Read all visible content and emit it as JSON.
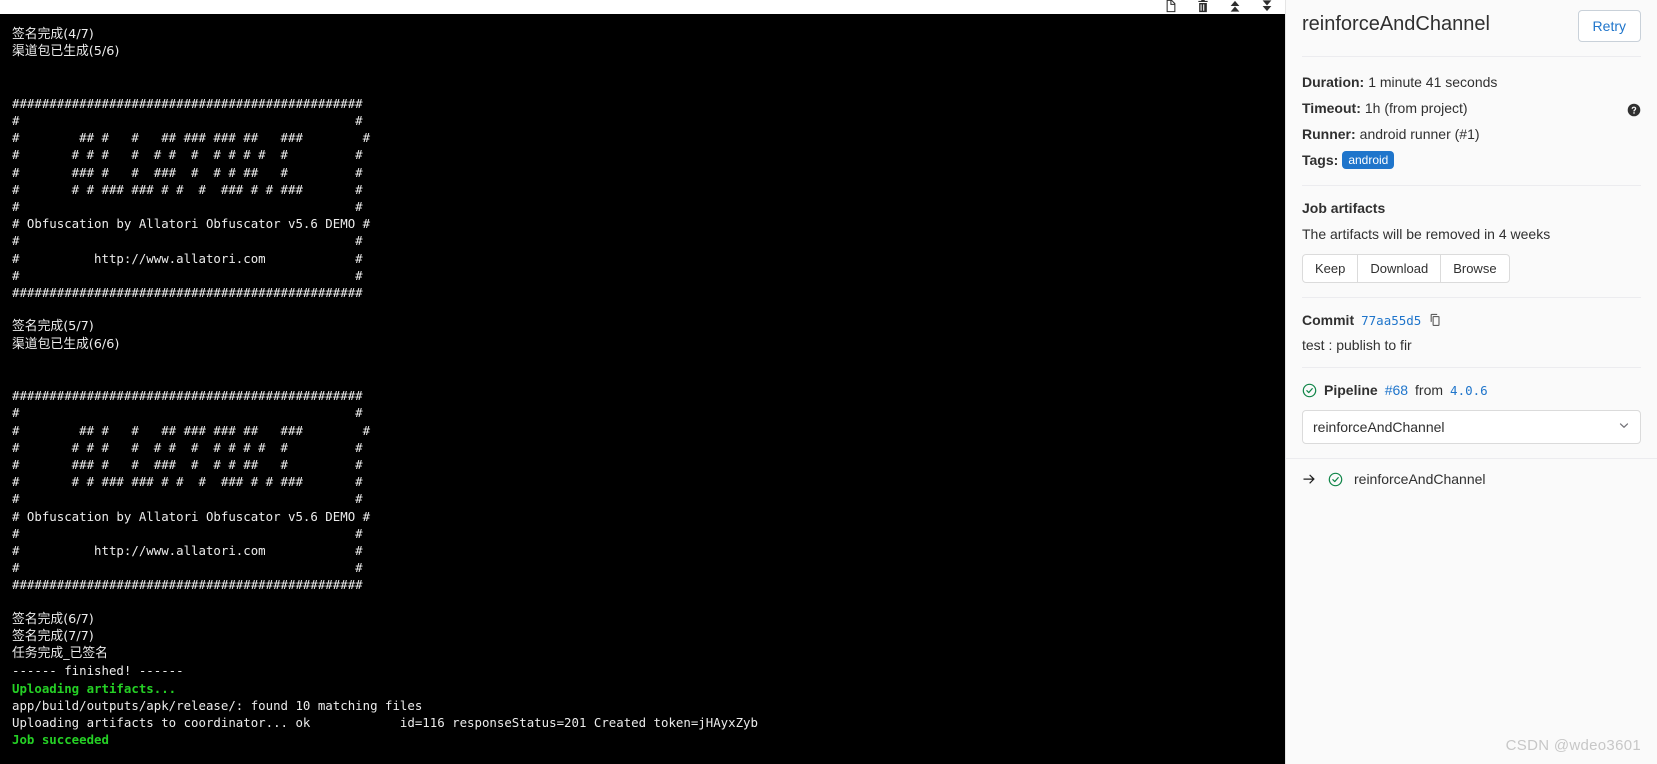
{
  "toolbar": {
    "icons": [
      {
        "name": "open-raw-icon",
        "title": "Show complete raw"
      },
      {
        "name": "trash-icon",
        "title": "Erase job log"
      },
      {
        "name": "scroll-top-icon",
        "title": "Scroll to top"
      },
      {
        "name": "scroll-bottom-icon",
        "title": "Scroll to bottom"
      }
    ]
  },
  "log": {
    "lines": [
      {
        "type": "cn",
        "text": "签名完成(4/7)"
      },
      {
        "type": "cn",
        "text": "渠道包已生成(5/6)"
      },
      {
        "type": "blank",
        "text": ""
      },
      {
        "type": "blank",
        "text": ""
      },
      {
        "type": "mono",
        "text": "###############################################"
      },
      {
        "type": "mono",
        "text": "#                                             #"
      },
      {
        "type": "mono",
        "text": "#        ## #   #   ## ### ### ##   ###        #"
      },
      {
        "type": "mono",
        "text": "#       # # #   #  # #  #  # # # #  #         #"
      },
      {
        "type": "mono",
        "text": "#       ### #   #  ###  #  # # ##   #         #"
      },
      {
        "type": "mono",
        "text": "#       # # ### ### # #  #  ### # # ###       #"
      },
      {
        "type": "mono",
        "text": "#                                             #"
      },
      {
        "type": "mono",
        "text": "# Obfuscation by Allatori Obfuscator v5.6 DEMO #"
      },
      {
        "type": "mono",
        "text": "#                                             #"
      },
      {
        "type": "mono",
        "text": "#          http://www.allatori.com            #"
      },
      {
        "type": "mono",
        "text": "#                                             #"
      },
      {
        "type": "mono",
        "text": "###############################################"
      },
      {
        "type": "blank",
        "text": ""
      },
      {
        "type": "cn",
        "text": "签名完成(5/7)"
      },
      {
        "type": "cn",
        "text": "渠道包已生成(6/6)"
      },
      {
        "type": "blank",
        "text": ""
      },
      {
        "type": "blank",
        "text": ""
      },
      {
        "type": "mono",
        "text": "###############################################"
      },
      {
        "type": "mono",
        "text": "#                                             #"
      },
      {
        "type": "mono",
        "text": "#        ## #   #   ## ### ### ##   ###        #"
      },
      {
        "type": "mono",
        "text": "#       # # #   #  # #  #  # # # #  #         #"
      },
      {
        "type": "mono",
        "text": "#       ### #   #  ###  #  # # ##   #         #"
      },
      {
        "type": "mono",
        "text": "#       # # ### ### # #  #  ### # # ###       #"
      },
      {
        "type": "mono",
        "text": "#                                             #"
      },
      {
        "type": "mono",
        "text": "# Obfuscation by Allatori Obfuscator v5.6 DEMO #"
      },
      {
        "type": "mono",
        "text": "#                                             #"
      },
      {
        "type": "mono",
        "text": "#          http://www.allatori.com            #"
      },
      {
        "type": "mono",
        "text": "#                                             #"
      },
      {
        "type": "mono",
        "text": "###############################################"
      },
      {
        "type": "blank",
        "text": ""
      },
      {
        "type": "cn",
        "text": "签名完成(6/7)"
      },
      {
        "type": "cn",
        "text": "签名完成(7/7)"
      },
      {
        "type": "cn",
        "text": "任务完成_已签名"
      },
      {
        "type": "mono",
        "text": "------ finished! ------"
      },
      {
        "type": "mono-green",
        "text": "Uploading artifacts..."
      },
      {
        "type": "mono",
        "text": "app/build/outputs/apk/release/: found 10 matching files"
      },
      {
        "type": "mono",
        "text": "Uploading artifacts to coordinator... ok            id=116 responseStatus=201 Created token=jHAyxZyb"
      },
      {
        "type": "mono-green",
        "text": "Job succeeded"
      }
    ]
  },
  "sidebar": {
    "job_title": "reinforceAndChannel",
    "retry_label": "Retry",
    "meta": {
      "duration_label": "Duration:",
      "duration_value": "1 minute 41 seconds",
      "timeout_label": "Timeout:",
      "timeout_value": "1h (from project)",
      "runner_label": "Runner:",
      "runner_value": "android runner (#1)",
      "tags_label": "Tags:",
      "tag_value": "android"
    },
    "artifacts": {
      "title": "Job artifacts",
      "note": "The artifacts will be removed in 4 weeks",
      "keep_label": "Keep",
      "download_label": "Download",
      "browse_label": "Browse"
    },
    "commit": {
      "label": "Commit",
      "sha": "77aa55d5",
      "message": "test : publish to fir"
    },
    "pipeline": {
      "label": "Pipeline",
      "number": "#68",
      "from_word": "from",
      "ref": "4.0.6",
      "stage_selected": "reinforceAndChannel"
    },
    "job_list": [
      {
        "name": "reinforceAndChannel",
        "status": "success"
      }
    ]
  },
  "watermark": "CSDN @wdeo3601",
  "colors": {
    "accent": "#1f75cb",
    "success": "#108548",
    "log_bg": "#000000",
    "log_fg": "#ececec",
    "log_green": "#25d025",
    "sidebar_bg": "#fafafa",
    "tag_bg": "#1f75cb"
  }
}
